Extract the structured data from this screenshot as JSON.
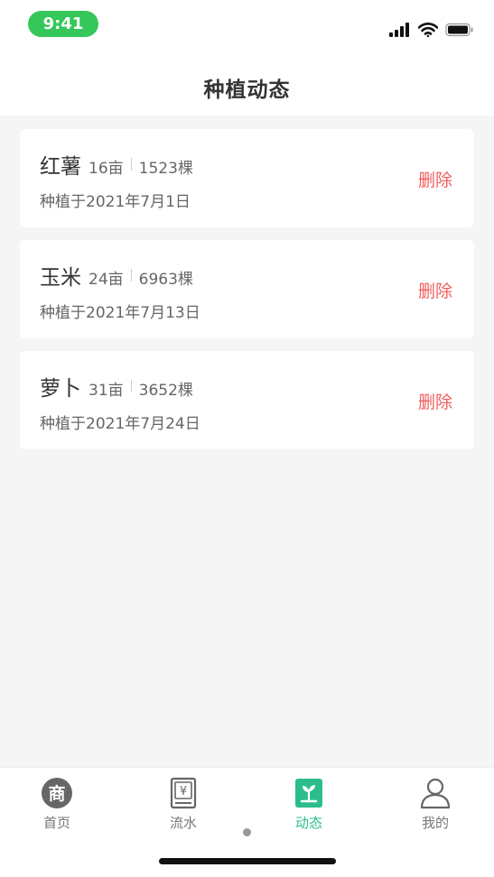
{
  "status": {
    "time": "9:41"
  },
  "nav": {
    "title": "种植动态"
  },
  "records": [
    {
      "name": "红薯",
      "area": "16亩",
      "count": "1523棵",
      "date": "种植于2021年7月1日",
      "action": "删除"
    },
    {
      "name": "玉米",
      "area": "24亩",
      "count": "6963棵",
      "date": "种植于2021年7月13日",
      "action": "删除"
    },
    {
      "name": "萝卜",
      "area": "31亩",
      "count": "3652棵",
      "date": "种植于2021年7月24日",
      "action": "删除"
    }
  ],
  "tabs": [
    {
      "label": "首页",
      "icon": "shop-icon"
    },
    {
      "label": "流水",
      "icon": "ledger-icon"
    },
    {
      "label": "动态",
      "icon": "sprout-icon",
      "active": true
    },
    {
      "label": "我的",
      "icon": "user-icon"
    }
  ],
  "colors": {
    "accent": "#2bbd8e",
    "danger": "#f25c5c",
    "time_pill": "#35c75a"
  }
}
